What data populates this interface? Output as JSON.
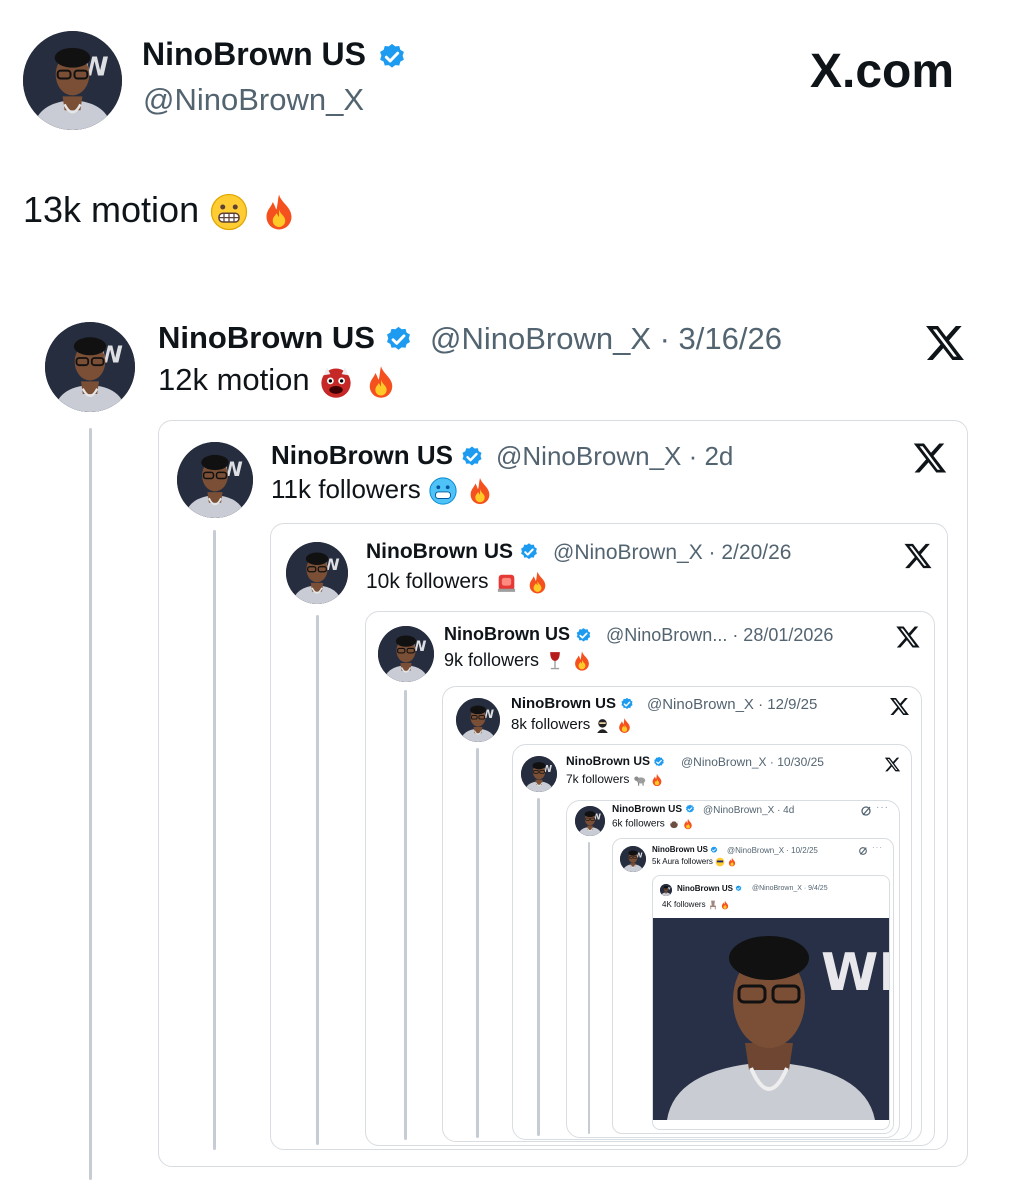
{
  "brand": {
    "site_label": "X.com"
  },
  "colors": {
    "verified": "#1d9bf0",
    "text": "#0f1419",
    "muted": "#536471",
    "border": "#d8dde2"
  },
  "post": {
    "author": {
      "name": "NinoBrown US",
      "handle": "@NinoBrown_X",
      "verified": true
    },
    "text": "13k motion"
  },
  "quotes": [
    {
      "name": "NinoBrown US",
      "meta": "@NinoBrown_X · 3/16/26",
      "text": "12k motion"
    },
    {
      "name": "NinoBrown US",
      "meta": "@NinoBrown_X · 2d",
      "text": "11k followers"
    },
    {
      "name": "NinoBrown US",
      "meta": "@NinoBrown_X · 2/20/26",
      "text": "10k followers"
    },
    {
      "name": "NinoBrown US",
      "meta": "@NinoBrown... · 28/01/2026",
      "text": "9k followers"
    },
    {
      "name": "NinoBrown US",
      "meta": "@NinoBrown_X · 12/9/25",
      "text": "8k followers"
    },
    {
      "name": "NinoBrown US",
      "meta": "@NinoBrown_X · 10/30/25",
      "text": "7k followers"
    },
    {
      "name": "NinoBrown US",
      "meta": "@NinoBrown_X · 4d",
      "text": "6k followers"
    },
    {
      "name": "NinoBrown US",
      "meta": "@NinoBrown_X · 10/2/25",
      "text": "5k Aura followers"
    },
    {
      "name": "NinoBrown US",
      "meta": "@NinoBrown_X · 9/4/25",
      "text": "4K followers"
    }
  ],
  "photo": {
    "backdrop_text": "WI"
  }
}
